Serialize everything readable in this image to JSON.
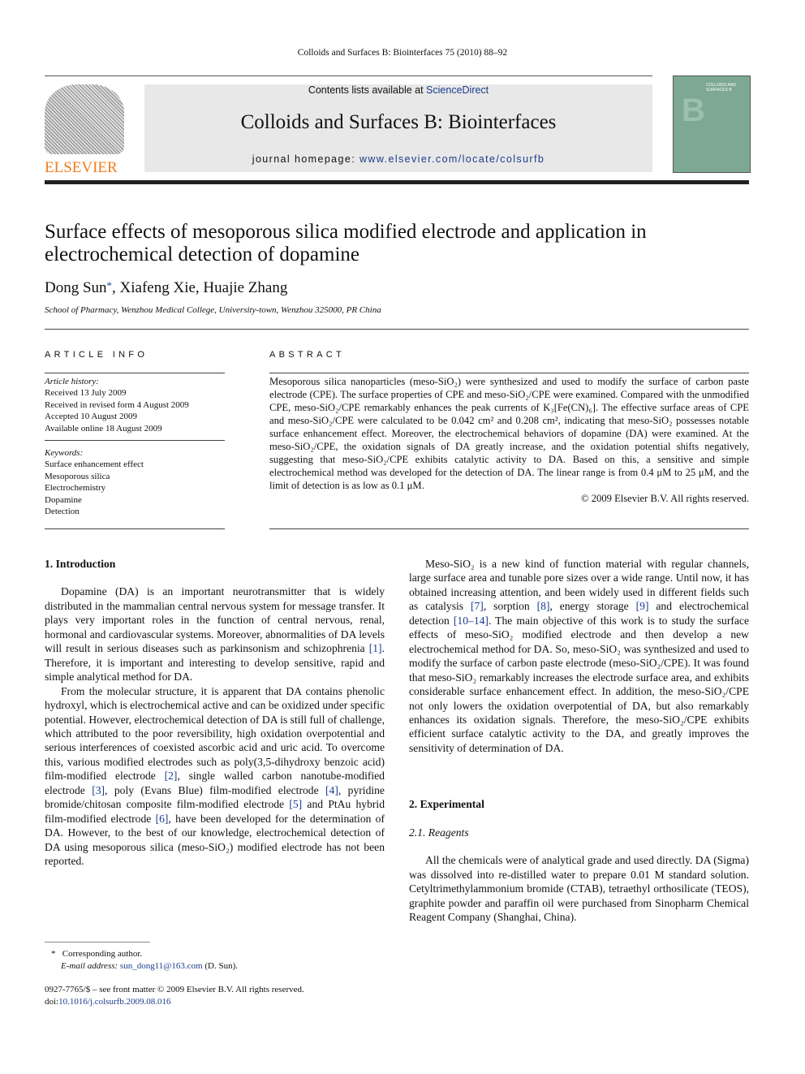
{
  "header": {
    "citation": "Colloids and Surfaces B: Biointerfaces 75 (2010) 88–92",
    "contents_prefix": "Contents lists available at ",
    "contents_link": "ScienceDirect",
    "journal_title": "Colloids and Surfaces B: Biointerfaces",
    "homepage_prefix": "journal homepage: ",
    "homepage_link": "www.elsevier.com/locate/colsurfb",
    "publisher_logo": "ELSEVIER",
    "cover_text": "COLLOIDS AND SURFACES B"
  },
  "article": {
    "title": "Surface effects of mesoporous silica modified electrode and application in electrochemical detection of dopamine",
    "authors": "Dong Sun",
    "author_mark": "*",
    "authors_rest": ", Xiafeng Xie, Huajie Zhang",
    "affiliation": "School of Pharmacy, Wenzhou Medical College, University-town, Wenzhou 325000, PR China"
  },
  "info": {
    "heading": "ARTICLE INFO",
    "history_label": "Article history:",
    "history": [
      "Received 13 July 2009",
      "Received in revised form 4 August 2009",
      "Accepted 10 August 2009",
      "Available online 18 August 2009"
    ],
    "keywords_label": "Keywords:",
    "keywords": [
      "Surface enhancement effect",
      "Mesoporous silica",
      "Electrochemistry",
      "Dopamine",
      "Detection"
    ]
  },
  "abstract": {
    "heading": "ABSTRACT",
    "text": "Mesoporous silica nanoparticles (meso-SiO₂) were synthesized and used to modify the surface of carbon paste electrode (CPE). The surface properties of CPE and meso-SiO₂/CPE were examined. Compared with the unmodified CPE, meso-SiO₂/CPE remarkably enhances the peak currents of K₃[Fe(CN)₆]. The effective surface areas of CPE and meso-SiO₂/CPE were calculated to be 0.042 cm² and 0.208 cm², indicating that meso-SiO₂ possesses notable surface enhancement effect. Moreover, the electrochemical behaviors of dopamine (DA) were examined. At the meso-SiO₂/CPE, the oxidation signals of DA greatly increase, and the oxidation potential shifts negatively, suggesting that meso-SiO₂/CPE exhibits catalytic activity to DA. Based on this, a sensitive and simple electrochemical method was developed for the detection of DA. The linear range is from 0.4 μM to 25 μM, and the limit of detection is as low as 0.1 μM.",
    "copyright": "© 2009 Elsevier B.V. All rights reserved."
  },
  "body": {
    "intro_heading": "1.  Introduction",
    "intro_p1": "Dopamine (DA) is an important neurotransmitter that is widely distributed in the mammalian central nervous system for message transfer. It plays very important roles in the function of central nervous, renal, hormonal and cardiovascular systems. Moreover, abnormalities of DA levels will result in serious diseases such as parkinsonism and schizophrenia [1]. Therefore, it is important and interesting to develop sensitive, rapid and simple analytical method for DA.",
    "intro_p2": "From the molecular structure, it is apparent that DA contains phenolic hydroxyl, which is electrochemical active and can be oxidized under specific potential. However, electrochemical detection of DA is still full of challenge, which attributed to the poor reversibility, high oxidation overpotential and serious interferences of coexisted ascorbic acid and uric acid. To overcome this, various modified electrodes such as poly(3,5-dihydroxy benzoic acid) film-modified electrode [2], single walled carbon nanotube-modified electrode [3], poly (Evans Blue) film-modified electrode [4], pyridine bromide/chitosan composite film-modified electrode [5] and PtAu hybrid film-modified electrode [6], have been developed for the determination of DA. However, to the best of our knowledge, electrochemical detection of DA using mesoporous silica (meso-SiO₂) modified electrode has not been reported.",
    "intro_p3": "Meso-SiO₂ is a new kind of function material with regular channels, large surface area and tunable pore sizes over a wide range. Until now, it has obtained increasing attention, and been widely used in different fields such as catalysis [7], sorption [8], energy storage [9] and electrochemical detection [10–14]. The main objective of this work is to study the surface effects of meso-SiO₂ modified electrode and then develop a new electrochemical method for DA. So, meso-SiO₂ was synthesized and used to modify the surface of carbon paste electrode (meso-SiO₂/CPE). It was found that meso-SiO₂ remarkably increases the electrode surface area, and exhibits considerable surface enhancement effect. In addition, the meso-SiO₂/CPE not only lowers the oxidation overpotential of DA, but also remarkably enhances its oxidation signals. Therefore, the meso-SiO₂/CPE exhibits efficient surface catalytic activity to the DA, and greatly improves the sensitivity of determination of DA.",
    "exp_heading": "2.  Experimental",
    "reagents_heading": "2.1.  Reagents",
    "reagents_p": "All the chemicals were of analytical grade and used directly. DA (Sigma) was dissolved into re-distilled water to prepare 0.01 M standard solution. Cetyltrimethylammonium bromide (CTAB), tetraethyl orthosilicate (TEOS), graphite powder and paraffin oil were purchased from Sinopharm Chemical Reagent Company (Shanghai, China)."
  },
  "footnote": {
    "mark": "*",
    "label": "Corresponding author.",
    "email_label": "E-mail address: ",
    "email": "sun_dong11@163.com",
    "email_suffix": " (D. Sun)."
  },
  "bottom": {
    "issn": "0927-7765/$ – see front matter © 2009 Elsevier B.V. All rights reserved.",
    "doi_label": "doi:",
    "doi": "10.1016/j.colsurfb.2009.08.016"
  },
  "colors": {
    "link": "#1a3c8c",
    "elsevier_orange": "#f07c1a",
    "banner_bg": "#e8e8e8"
  }
}
